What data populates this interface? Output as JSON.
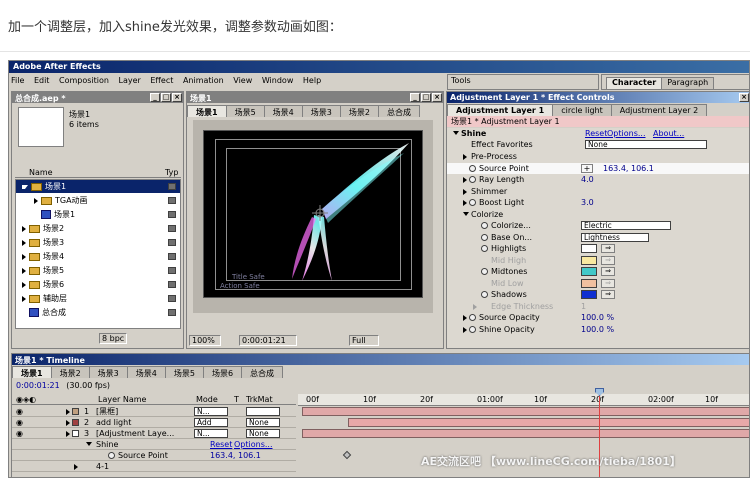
{
  "caption": "加一个调整层，加入shine发光效果，调整参数动画如图：",
  "app": {
    "title": "Adobe After Effects",
    "menu": [
      "File",
      "Edit",
      "Composition",
      "Layer",
      "Effect",
      "Animation",
      "View",
      "Window",
      "Help"
    ]
  },
  "project": {
    "title": "总合成.aep *",
    "selected_name": "场景1",
    "selected_info": "6 items",
    "col_name": "Name",
    "col_type": "Typ",
    "items": [
      {
        "label": "场景1",
        "kind": "folder",
        "open": true,
        "indent": 0,
        "selected": true
      },
      {
        "label": "TGA动画",
        "kind": "folder",
        "open": false,
        "indent": 1,
        "selected": false
      },
      {
        "label": "场景1",
        "kind": "comp",
        "open": false,
        "indent": 1,
        "selected": false
      },
      {
        "label": "场景2",
        "kind": "folder",
        "open": false,
        "indent": 0,
        "selected": false
      },
      {
        "label": "场景3",
        "kind": "folder",
        "open": false,
        "indent": 0,
        "selected": false
      },
      {
        "label": "场景4",
        "kind": "folder",
        "open": false,
        "indent": 0,
        "selected": false
      },
      {
        "label": "场景5",
        "kind": "folder",
        "open": false,
        "indent": 0,
        "selected": false
      },
      {
        "label": "场景6",
        "kind": "folder",
        "open": false,
        "indent": 0,
        "selected": false
      },
      {
        "label": "辅助层",
        "kind": "folder",
        "open": false,
        "indent": 0,
        "selected": false
      },
      {
        "label": "总合成",
        "kind": "comp",
        "open": false,
        "indent": 0,
        "selected": false
      }
    ],
    "bpc": "8 bpc"
  },
  "comp": {
    "title": "场景1",
    "tabs": [
      "场景1",
      "场景5",
      "场景4",
      "场景3",
      "场景2",
      "总合成"
    ],
    "zoom": "100%",
    "time": "0:00:01:21",
    "resolution": "Full",
    "title_safe": "Title Safe",
    "action_safe": "Action Safe"
  },
  "tools": {
    "title": "Tools"
  },
  "char": {
    "tabs": [
      "Character",
      "Paragraph"
    ]
  },
  "effects": {
    "title": "Adjustment Layer 1 * Effect Controls",
    "tabs": [
      "Adjustment Layer 1",
      "circle light",
      "Adjustment Layer 2"
    ],
    "header": "场景1 * Adjustment Layer 1",
    "effect_name": "Shine",
    "reset": "Reset",
    "options": "Options...",
    "about": "About...",
    "favorites_label": "Effect Favorites",
    "favorites_value": "None",
    "rows": {
      "preprocess": "Pre-Process",
      "source_point": "Source Point",
      "source_point_val": "163.4, 106.1",
      "ray_length": "Ray Length",
      "ray_length_val": "4.0",
      "shimmer": "Shimmer",
      "boost_light": "Boost Light",
      "boost_light_val": "3.0",
      "colorize": "Colorize",
      "colorize_dd_label": "Colorize...",
      "colorize_dd_val": "Electric",
      "base_on": "Base On...",
      "base_on_val": "Lightness",
      "highlights": "Highligts",
      "mid_high": "Mid High",
      "midtones": "Midtones",
      "mid_low": "Mid Low",
      "shadows": "Shadows",
      "edge_thickness": "Edge Thickness",
      "edge_thickness_val": "1",
      "source_opacity": "Source Opacity",
      "source_opacity_val": "100.0 %",
      "shine_opacity": "Shine Opacity",
      "shine_opacity_val": "100.0 %"
    },
    "colors": {
      "highlights": "#ffffff",
      "mid_high": "#f8e8a0",
      "midtones": "#40c8c8",
      "mid_low": "#f0c0a0",
      "shadows": "#1030d0"
    }
  },
  "timeline": {
    "title": "场景1 * Timeline",
    "tabs": [
      "场景1",
      "场景2",
      "场景3",
      "场景4",
      "场景5",
      "场景6",
      "总合成"
    ],
    "time": "0:00:01:21",
    "fps": "(30.00 fps)",
    "col_layer": "Layer Name",
    "col_mode": "Mode",
    "col_t": "T",
    "col_trkmat": "TrkMat",
    "ruler": [
      "00f",
      "10f",
      "20f",
      "01:00f",
      "10f",
      "20f",
      "02:00f",
      "10f"
    ],
    "layers": [
      {
        "num": "1",
        "name": "[黑框]",
        "mode": "N...",
        "trk": "",
        "color": "#c0a080"
      },
      {
        "num": "2",
        "name": "add light",
        "mode": "Add",
        "trk": "None",
        "color": "#a04040"
      },
      {
        "num": "3",
        "name": "[Adjustment Laye...",
        "mode": "N...",
        "trk": "None",
        "color": "#ffffff"
      }
    ],
    "shine_label": "Shine",
    "shine_reset": "Reset",
    "shine_options": "Options...",
    "sp_label": "Source Point",
    "sp_val": "163.4, 106.1",
    "row_last": "4-1"
  },
  "watermark": "AE交流区吧 【www.lineCG.com/tieba/1801】"
}
